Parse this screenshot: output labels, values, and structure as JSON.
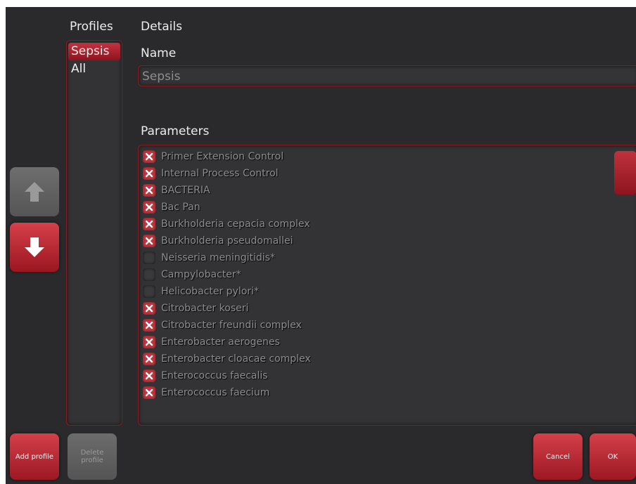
{
  "profiles": {
    "header": "Profiles",
    "items": [
      {
        "label": "Sepsis",
        "selected": true
      },
      {
        "label": "All",
        "selected": false
      }
    ]
  },
  "details": {
    "header": "Details",
    "name_label": "Name",
    "name_value": "Sepsis",
    "parameters_label": "Parameters"
  },
  "parameters": [
    {
      "label": "Primer Extension Control",
      "checked": true
    },
    {
      "label": "Internal Process Control",
      "checked": true
    },
    {
      "label": "BACTERIA",
      "checked": true
    },
    {
      "label": "Bac Pan",
      "checked": true
    },
    {
      "label": "Burkholderia cepacia complex",
      "checked": true
    },
    {
      "label": "Burkholderia pseudomallei",
      "checked": true
    },
    {
      "label": "Neisseria meningitidis*",
      "checked": false
    },
    {
      "label": "Campylobacter*",
      "checked": false
    },
    {
      "label": "Helicobacter pylori*",
      "checked": false
    },
    {
      "label": "Citrobacter koseri",
      "checked": true
    },
    {
      "label": "Citrobacter freundii complex",
      "checked": true
    },
    {
      "label": "Enterobacter aerogenes",
      "checked": true
    },
    {
      "label": "Enterobacter cloacae complex",
      "checked": true
    },
    {
      "label": "Enterococcus faecalis",
      "checked": true
    },
    {
      "label": "Enterococcus faecium",
      "checked": true
    }
  ],
  "buttons": {
    "add_profile": "Add profile",
    "delete_profile": "Delete\nprofile",
    "cancel": "Cancel",
    "ok": "OK"
  },
  "icons": {
    "move_up": "arrow-up-icon",
    "move_down": "arrow-down-icon",
    "checkbox_checked": "x-mark-icon"
  },
  "colors": {
    "accent": "#b32a34",
    "background": "#2a2a2c"
  }
}
